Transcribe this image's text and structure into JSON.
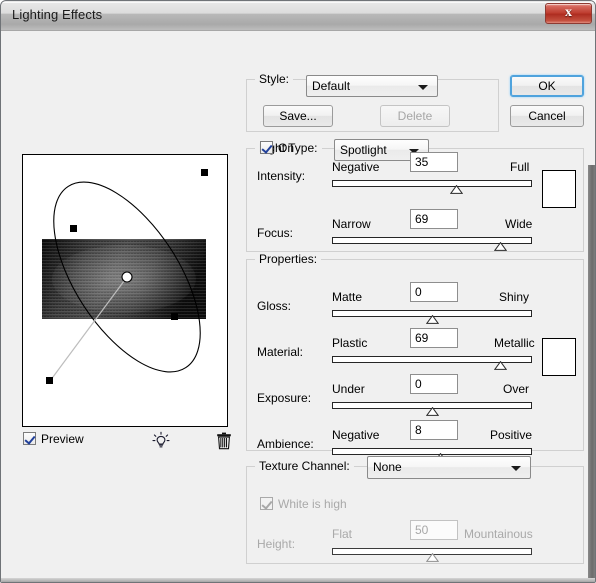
{
  "window": {
    "title": "Lighting Effects",
    "close_label": "x"
  },
  "preview": {
    "checkbox_label": "Preview",
    "checked": true,
    "bulb_icon": "light-bulb-icon",
    "trash_icon": "trash-icon"
  },
  "style_group": {
    "legend": "Style:",
    "selected": "Default",
    "save_label": "Save...",
    "delete_label": "Delete",
    "delete_disabled": true
  },
  "actions": {
    "ok_label": "OK",
    "cancel_label": "Cancel"
  },
  "light_type_group": {
    "legend": "Light Type:",
    "selected": "Spotlight",
    "on_label": "On",
    "on_checked": true,
    "swatch_color": "#ffffff",
    "sliders": [
      {
        "name": "Intensity:",
        "left_label": "Negative",
        "right_label": "Full",
        "value": "35",
        "percent": 62
      },
      {
        "name": "Focus:",
        "left_label": "Narrow",
        "right_label": "Wide",
        "value": "69",
        "percent": 84
      }
    ]
  },
  "properties_group": {
    "legend": "Properties:",
    "swatch_color": "#ffffff",
    "sliders": [
      {
        "name": "Gloss:",
        "left_label": "Matte",
        "right_label": "Shiny",
        "value": "0",
        "percent": 50
      },
      {
        "name": "Material:",
        "left_label": "Plastic",
        "right_label": "Metallic",
        "value": "69",
        "percent": 84
      },
      {
        "name": "Exposure:",
        "left_label": "Under",
        "right_label": "Over",
        "value": "0",
        "percent": 50
      },
      {
        "name": "Ambience:",
        "left_label": "Negative",
        "right_label": "Positive",
        "value": "8",
        "percent": 54
      }
    ]
  },
  "texture_group": {
    "legend": "Texture Channel:",
    "selected": "None",
    "white_is_high_label": "White is high",
    "white_is_high_checked": true,
    "white_is_high_disabled": true,
    "height_slider": {
      "name": "Height:",
      "left_label": "Flat",
      "right_label": "Mountainous",
      "value": "50",
      "percent": 50,
      "disabled": true
    }
  }
}
